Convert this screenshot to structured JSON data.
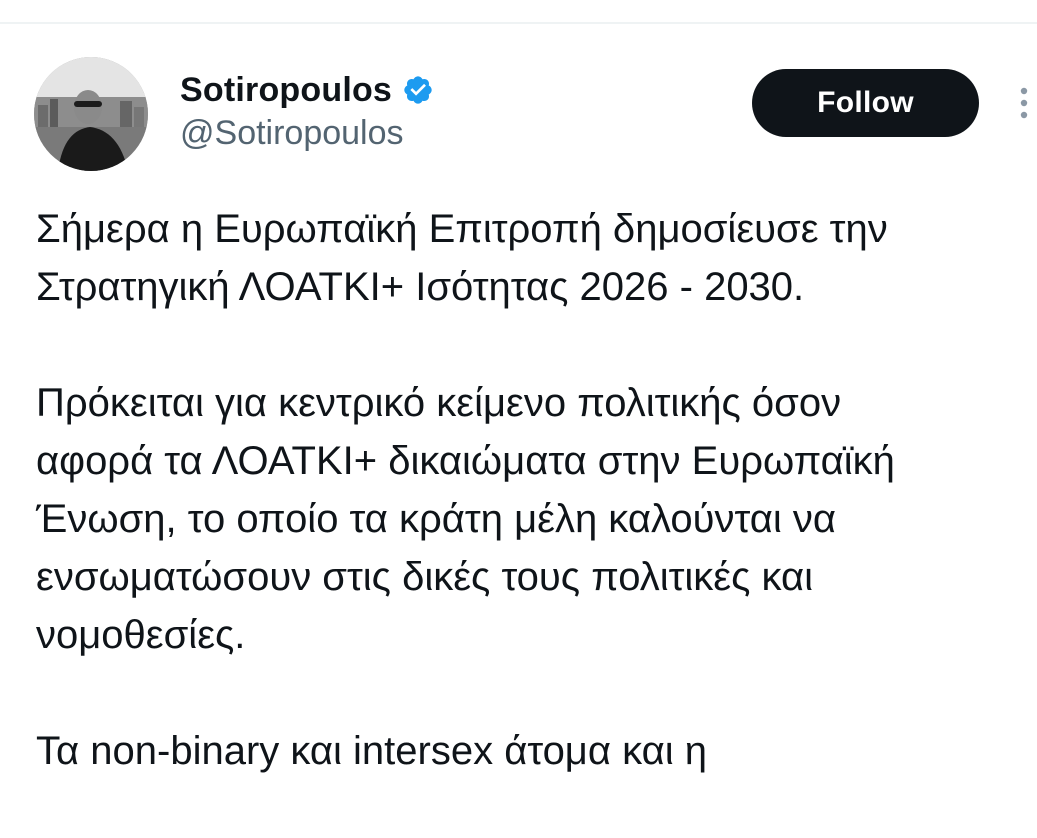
{
  "author": {
    "display_name": "Sotiropoulos",
    "handle": "@Sotiropoulos",
    "verified_icon": "verified-badge-icon"
  },
  "actions": {
    "follow_label": "Follow",
    "more_icon": "more-vertical-icon"
  },
  "tweet": {
    "paragraphs": [
      {
        "lines": [
          "Σήμερα η Ευρωπαϊκή Επιτροπή δημοσίευσε την",
          "Στρατηγική ΛΟΑΤΚΙ+ Ισότητας 2026 - 2030."
        ]
      },
      {
        "lines": [
          "Πρόκειται για κεντρικό κείμενο πολιτικής όσον",
          "αφορά τα ΛΟΑΤΚΙ+ δικαιώματα στην Ευρωπαϊκή",
          "Ένωση, το οποίο τα κράτη μέλη καλούνται να",
          "ενσωματώσουν στις δικές τους πολιτικές και",
          "νομοθεσίες."
        ]
      },
      {
        "lines": [
          "Τα non-binary και intersex άτομα και η"
        ]
      }
    ]
  },
  "colors": {
    "text_primary": "#0f1419",
    "text_secondary": "#536471",
    "verified_blue": "#1d9bf0",
    "follow_bg": "#0f1419",
    "follow_text": "#ffffff"
  }
}
